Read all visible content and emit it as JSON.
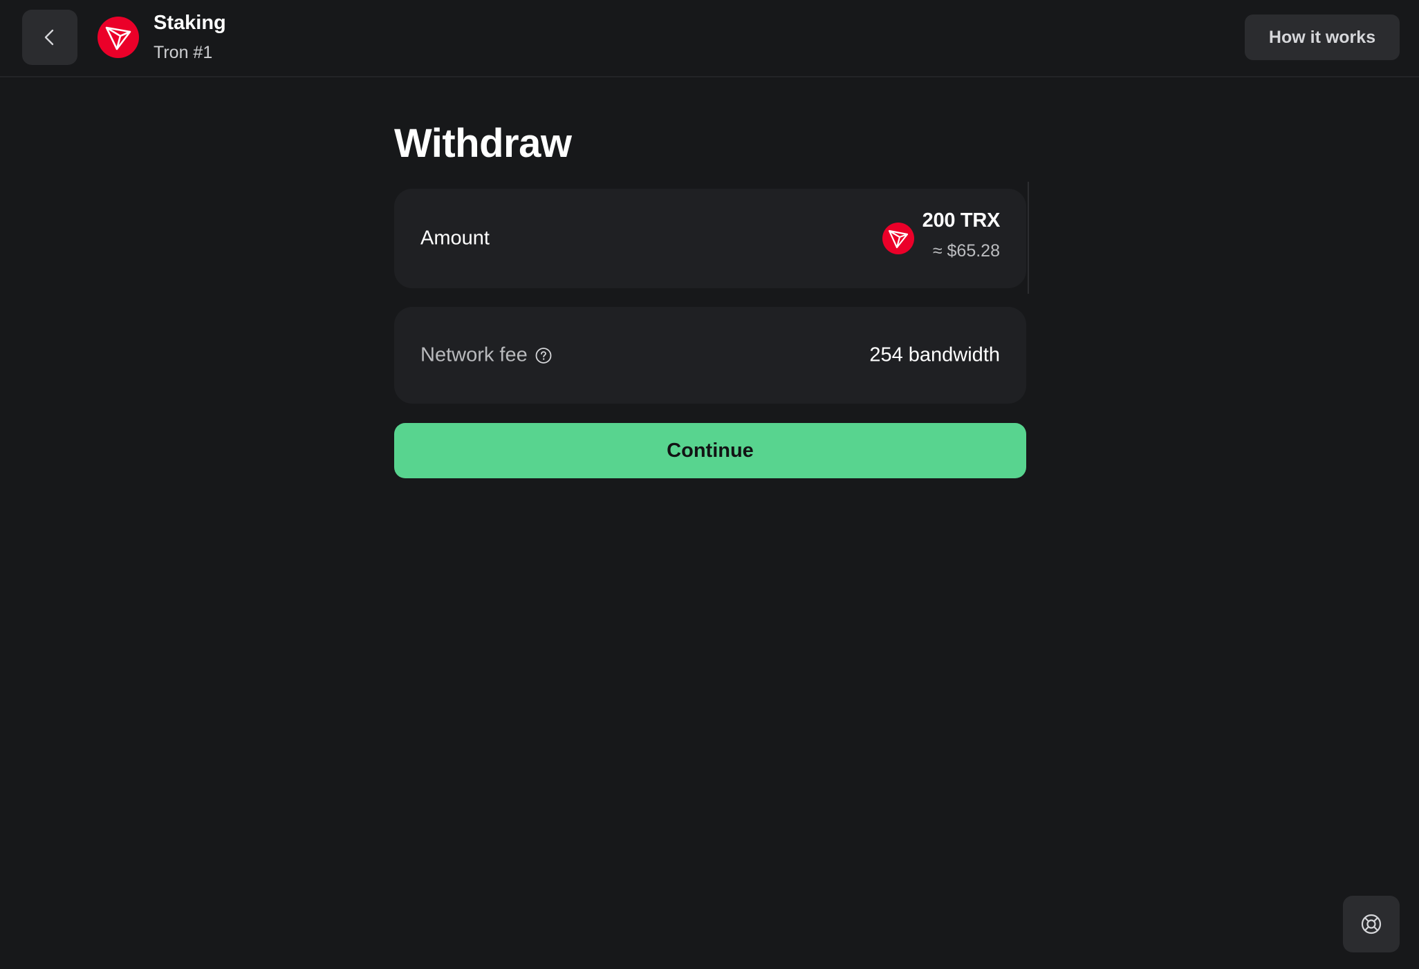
{
  "header": {
    "back_icon": "chevron-left-icon",
    "logo_icon": "tron-logo-icon",
    "title": "Staking",
    "subtitle": "Tron #1",
    "how_it_works_label": "How it works"
  },
  "main": {
    "title": "Withdraw",
    "amount": {
      "label": "Amount",
      "token_icon": "tron-logo-icon",
      "value": "200 TRX",
      "fiat_value": "≈ $65.28"
    },
    "network_fee": {
      "label": "Network fee",
      "help_icon": "question-circle-icon",
      "value": "254 bandwidth"
    },
    "continue_label": "Continue"
  },
  "support": {
    "icon": "lifebuoy-icon"
  },
  "colors": {
    "background": "#17181a",
    "card": "#1f2023",
    "button_secondary": "#2b2c2f",
    "accent_green": "#58d48f",
    "tron_red": "#eb0029"
  }
}
